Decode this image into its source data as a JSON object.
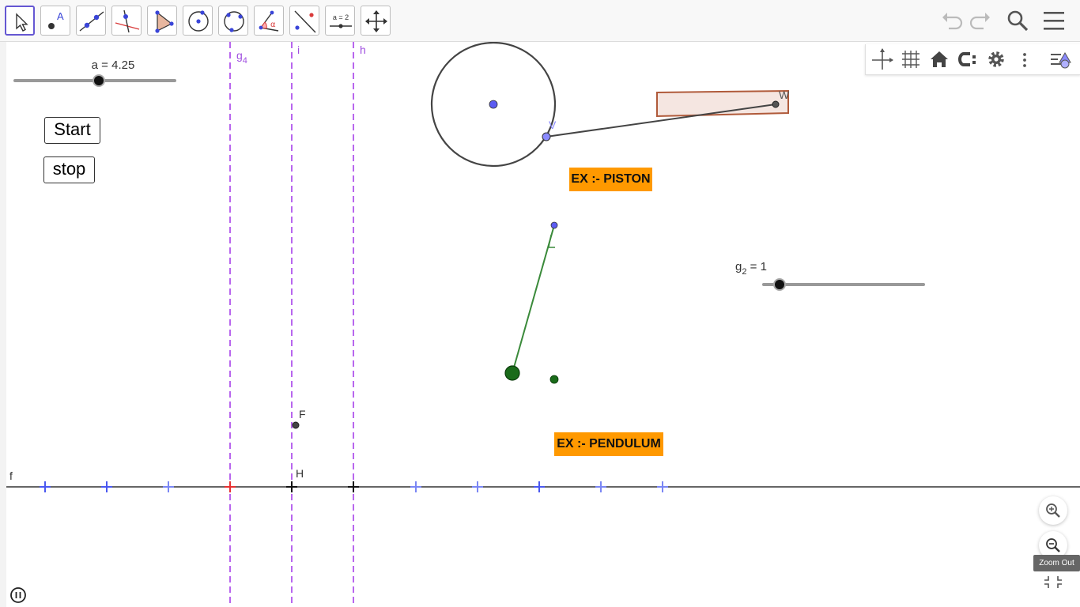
{
  "toolbar": {
    "tools": [
      {
        "name": "move-tool",
        "icon": "cursor-icon",
        "active": true
      },
      {
        "name": "point-tool",
        "icon": "point-icon",
        "icon_text": "A"
      },
      {
        "name": "line-tool",
        "icon": "line-icon"
      },
      {
        "name": "perpendicular-line-tool",
        "icon": "perpendicular-icon"
      },
      {
        "name": "polygon-tool",
        "icon": "polygon-icon"
      },
      {
        "name": "circle-center-point-tool",
        "icon": "circle-icon"
      },
      {
        "name": "circle-three-points-tool",
        "icon": "circle-3pts-icon"
      },
      {
        "name": "angle-tool",
        "icon": "angle-icon",
        "icon_text": "α"
      },
      {
        "name": "reflect-tool",
        "icon": "reflect-icon"
      },
      {
        "name": "slider-tool",
        "icon": "slider-icon",
        "icon_text": "a = 2"
      },
      {
        "name": "move-graphics-view-tool",
        "icon": "move-view-icon"
      }
    ],
    "right": [
      "undo-icon",
      "redo-icon",
      "search-icon",
      "menu-icon"
    ]
  },
  "style_bar": [
    "axes-icon",
    "grid-icon",
    "home-icon",
    "point-capturing-icon",
    "settings-icon",
    "more-vert-icon",
    "view-toggle-icon"
  ],
  "sliders": {
    "a": {
      "label": "a = 4.25",
      "value": 4.25
    },
    "g2": {
      "label_main": "g",
      "label_sub": "2",
      "label_rest": " = 1",
      "value": 1
    }
  },
  "buttons": {
    "start": "Start",
    "stop": "stop"
  },
  "text_boxes": {
    "piston": "EX :- PISTON",
    "pendulum": "EX :- PENDULUM"
  },
  "labels": {
    "line_g4_main": "g",
    "line_g4_sub": "4",
    "line_i": "i",
    "line_h": "h",
    "point_v": "V",
    "point_w": "W",
    "point_f": "F",
    "point_h": "H",
    "axis_f": "f"
  },
  "zoom": {
    "tooltip": "Zoom Out",
    "icons": [
      "zoom-in-icon",
      "zoom-out-icon",
      "fullscreen-exit-icon"
    ]
  },
  "colors": {
    "accent": "#6557d2",
    "dashed_lines": "#b866ee",
    "point_blue": "#6b6bff",
    "pendulum_green": "#2e7d32",
    "label_orange": "#ff9900",
    "piston_fill": "#f5e6e1",
    "piston_stroke": "#b05a3a"
  }
}
